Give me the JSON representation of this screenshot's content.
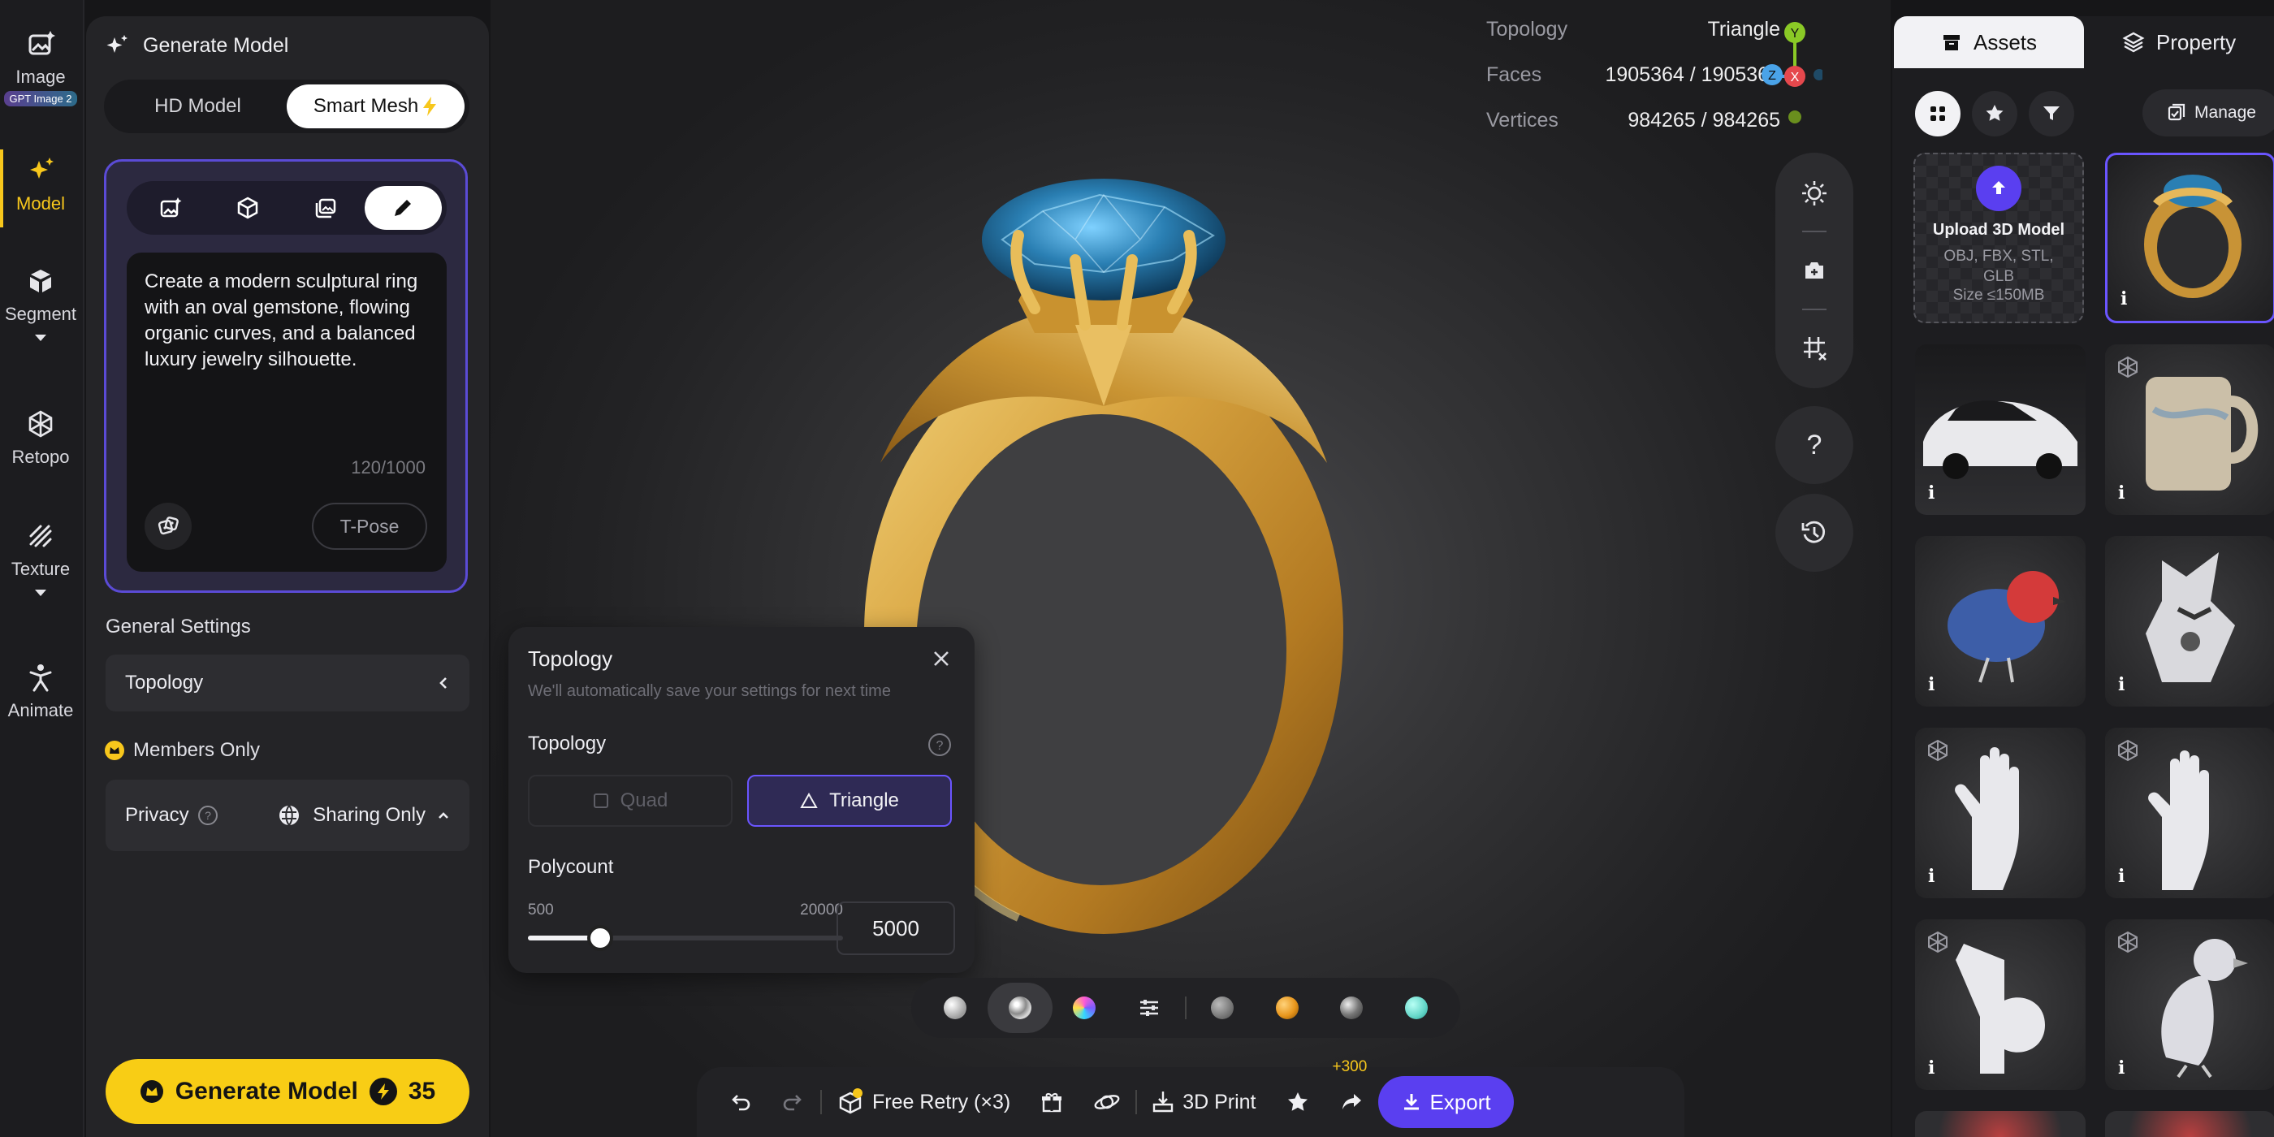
{
  "rail": {
    "items": [
      {
        "label": "Image",
        "badge": "GPT Image 2",
        "icon": "image-sparkle-icon"
      },
      {
        "label": "Model",
        "icon": "sparkle-icon"
      },
      {
        "label": "Segment",
        "icon": "cube-split-icon"
      },
      {
        "label": "Retopo",
        "icon": "mesh-icon"
      },
      {
        "label": "Texture",
        "icon": "texture-icon"
      },
      {
        "label": "Animate",
        "icon": "figure-icon"
      }
    ],
    "active": "Model"
  },
  "left_panel": {
    "title": "Generate Model",
    "modes": [
      "HD Model",
      "Smart Mesh"
    ],
    "active_mode": "Smart Mesh",
    "input_tools": [
      "image-input-icon",
      "cube-icon",
      "multi-image-icon",
      "pencil-icon"
    ],
    "prompt_text": "Create a modern sculptural ring with an oval gemstone, flowing organic curves, and a balanced luxury jewelry silhouette.",
    "char_count": "120/1000",
    "tpose_label": "T-Pose",
    "general_settings": "General Settings",
    "topology_row": "Topology",
    "members_only": "Members Only",
    "privacy_label": "Privacy",
    "privacy_value": "Sharing Only",
    "generate_label": "Generate Model",
    "generate_cost": "35"
  },
  "viewport": {
    "stats": {
      "topology_label": "Topology",
      "topology_value": "Triangle",
      "faces_label": "Faces",
      "faces_value": "1905364 / 1905364",
      "vertices_label": "Vertices",
      "vertices_value": "984265 / 984265"
    },
    "axes": {
      "y": "Y",
      "z": "Z",
      "x": "X"
    },
    "help": "?"
  },
  "topology_popup": {
    "title": "Topology",
    "subtitle": "We'll automatically save your settings for next time",
    "topology_label": "Topology",
    "options": [
      "Quad",
      "Triangle"
    ],
    "selected": "Triangle",
    "polycount_label": "Polycount",
    "min": "500",
    "max": "20000",
    "value": "5000",
    "slider_fraction": 0.23
  },
  "material_bar": {
    "colors": [
      "#d6d6d6",
      "#bdbdbd",
      "#7b5cff",
      "#888888",
      "#e8961c",
      "#9a9a9a",
      "#63d6c8"
    ]
  },
  "action_bar": {
    "free_retry": "Free Retry (×3)",
    "print": "3D Print",
    "share_bonus": "+300",
    "export": "Export"
  },
  "right_panel": {
    "tabs": [
      "Assets",
      "Property"
    ],
    "active_tab": "Assets",
    "manage": "Manage",
    "upload_title": "Upload 3D Model",
    "upload_formats": "OBJ, FBX, STL, GLB",
    "upload_size": "Size ≤150MB",
    "tiles": [
      "gold ring",
      "white car",
      "mug",
      "bird",
      "robot",
      "hand",
      "hand",
      "hand gesture",
      "bird statue"
    ]
  }
}
